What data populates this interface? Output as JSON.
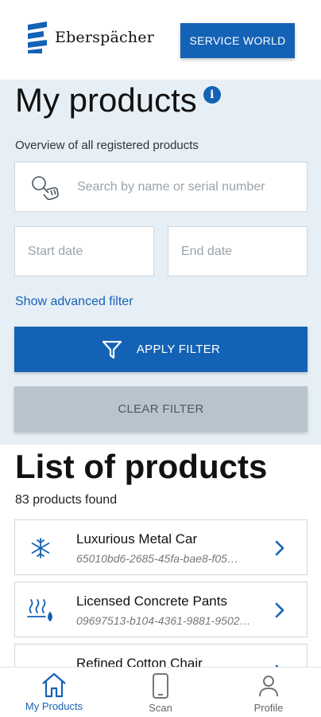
{
  "header": {
    "brand_name": "Eberspächer",
    "service_button_label": "SERVICE WORLD"
  },
  "filter": {
    "title": "My products",
    "subtitle": "Overview of all registered products",
    "search_placeholder": "Search by name or serial number",
    "start_date_placeholder": "Start date",
    "end_date_placeholder": "End date",
    "advanced_filter_label": "Show advanced filter",
    "apply_button_label": "APPLY FILTER",
    "clear_button_label": "CLEAR FILTER"
  },
  "products": {
    "title": "List of products",
    "count_text": "83 products found",
    "items": [
      {
        "name": "Luxurious Metal Car",
        "serial": "65010bd6-2685-45fa-bae8-f05…",
        "icon": "snowflake-icon"
      },
      {
        "name": "Licensed Concrete Pants",
        "serial": "09697513-b104-4361-9881-9502…",
        "icon": "heater-icon"
      },
      {
        "name": "Refined Cotton Chair",
        "serial": "",
        "icon": "device-icon"
      }
    ]
  },
  "bottom_nav": {
    "items": [
      {
        "label": "My Products",
        "icon": "home-icon",
        "active": true
      },
      {
        "label": "Scan",
        "icon": "phone-icon",
        "active": false
      },
      {
        "label": "Profile",
        "icon": "person-icon",
        "active": false
      }
    ]
  },
  "colors": {
    "primary": "#1462b5",
    "panel_background": "#e7eff6",
    "clear_button": "#b8c4cb"
  }
}
